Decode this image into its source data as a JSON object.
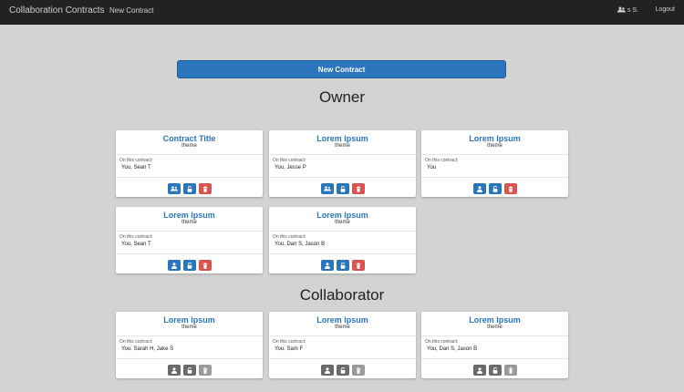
{
  "navbar": {
    "brand": "Collaboration Contracts",
    "new_contract_link": "New Contract",
    "user_label": "s S.",
    "logout": "Logout"
  },
  "main": {
    "new_contract_button": "New Contract",
    "owner_heading": "Owner",
    "collaborator_heading": "Collaborator"
  },
  "owner_cards": [
    {
      "title": "Contract Title",
      "theme": "theme",
      "label": "On this contract:",
      "people": "You, Sean T",
      "share_icon": "users-icon"
    },
    {
      "title": "Lorem Ipsum",
      "theme": "theme",
      "label": "On this contract:",
      "people": "You, Jesse P",
      "share_icon": "users-icon"
    },
    {
      "title": "Lorem Ipsum",
      "theme": "theme",
      "label": "On this contract:",
      "people": "You",
      "share_icon": "user-icon"
    },
    {
      "title": "Lorem Ipsum",
      "theme": "theme",
      "label": "On this contract:",
      "people": "You, Sean T",
      "share_icon": "user-icon"
    },
    {
      "title": "Lorem Ipsum",
      "theme": "theme",
      "label": "On this contract:",
      "people": "You, Dan S, Jason B",
      "share_icon": "user-icon"
    }
  ],
  "collaborator_cards": [
    {
      "title": "Lorem Ipsum",
      "theme": "theme",
      "label": "On this contract:",
      "people": "You, Sarah H, Jake S",
      "share_icon": "user-icon"
    },
    {
      "title": "Lorem Ipsum",
      "theme": "theme",
      "label": "On this contract:",
      "people": "You, Sam F",
      "share_icon": "user-icon"
    },
    {
      "title": "Lorem Ipsum",
      "theme": "theme",
      "label": "On this contract:",
      "people": "You, Dan S, Jason B",
      "share_icon": "user-icon"
    }
  ],
  "colors": {
    "navbar": "#222222",
    "background": "#d3d3d3",
    "primary": "#2a75bb",
    "danger": "#d9534f",
    "disabled_dark": "#6a6a6a",
    "disabled_light": "#9a9a9a"
  }
}
